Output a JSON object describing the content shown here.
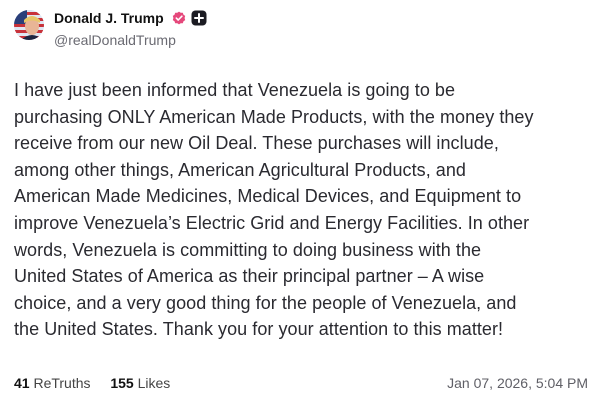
{
  "author": {
    "display_name": "Donald J. Trump",
    "handle": "@realDonaldTrump",
    "verified_color": "#e5487b"
  },
  "post": {
    "lines": [
      "I have just been informed that Venezuela is going to be",
      "purchasing ONLY American Made Products, with the money they",
      "receive from our new Oil Deal. These purchases will include,",
      "among other things, American Agricultural Products, and",
      "American Made Medicines, Medical Devices, and Equipment to",
      "improve Venezuela’s Electric Grid and Energy Facilities. In other",
      "words, Venezuela is committing to doing business with the",
      "United States of America as their principal partner – A wise",
      "choice, and a very good thing for the people of Venezuela, and",
      "the United States. Thank you for your attention to this matter!"
    ]
  },
  "stats": {
    "retruths_count": "41",
    "retruths_label": "ReTruths",
    "likes_count": "155",
    "likes_label": "Likes",
    "timestamp": "Jan 07, 2026, 5:04 PM"
  }
}
